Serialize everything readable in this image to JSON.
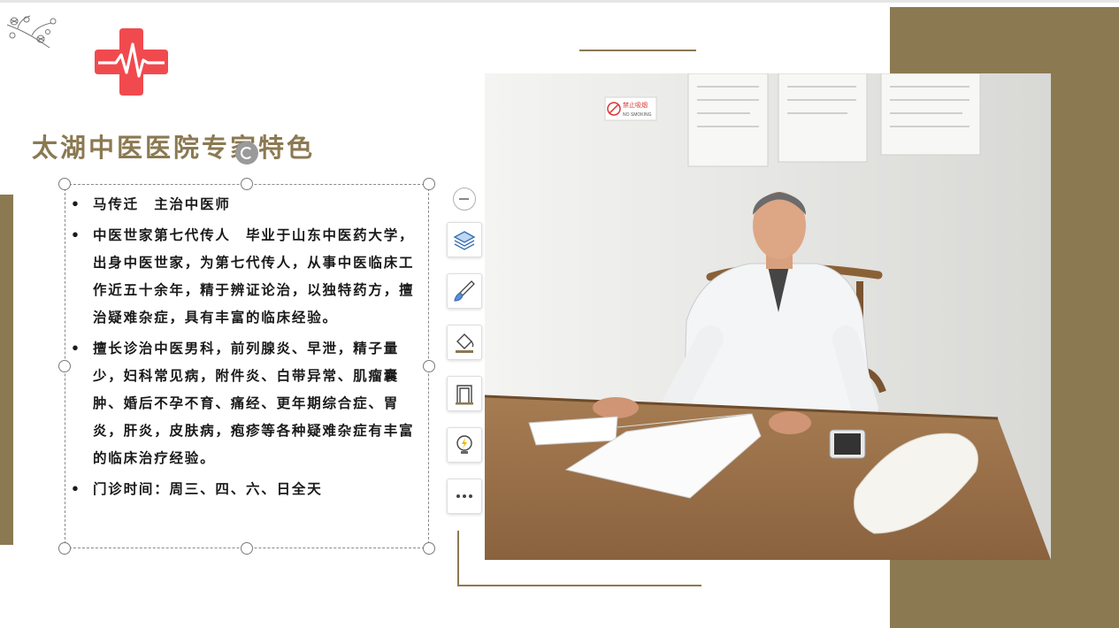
{
  "title": "太湖中医医院专家特色",
  "content": {
    "items": [
      "马传迁　主治中医师",
      "中医世家第七代传人　毕业于山东中医药大学，出身中医世家，为第七代传人，从事中医临床工作近五十余年，精于辨证论治，以独特药方，擅治疑难杂症，具有丰富的临床经验。",
      "擅长诊治中医男科，前列腺炎、早泄，精子量少，妇科常见病，附件炎、白带异常、肌瘤囊肿、婚后不孕不育、痛经、更年期综合症、胃炎，肝炎，皮肤病，疱疹等各种疑难杂症有丰富的临床治疗经验。",
      "门诊时间：周三、四、六、日全天"
    ]
  },
  "photo": {
    "sign_text": "禁止吸烟",
    "sign_subtext": "NO SMOKING"
  },
  "toolbar": {
    "buttons": [
      "collapse-icon",
      "layers-icon",
      "brush-icon",
      "fill-icon",
      "frame-icon",
      "idea-icon",
      "more-icon"
    ]
  },
  "colors": {
    "accent": "#8b7952",
    "cross": "#f04a4f",
    "text": "#1a1a1a"
  }
}
